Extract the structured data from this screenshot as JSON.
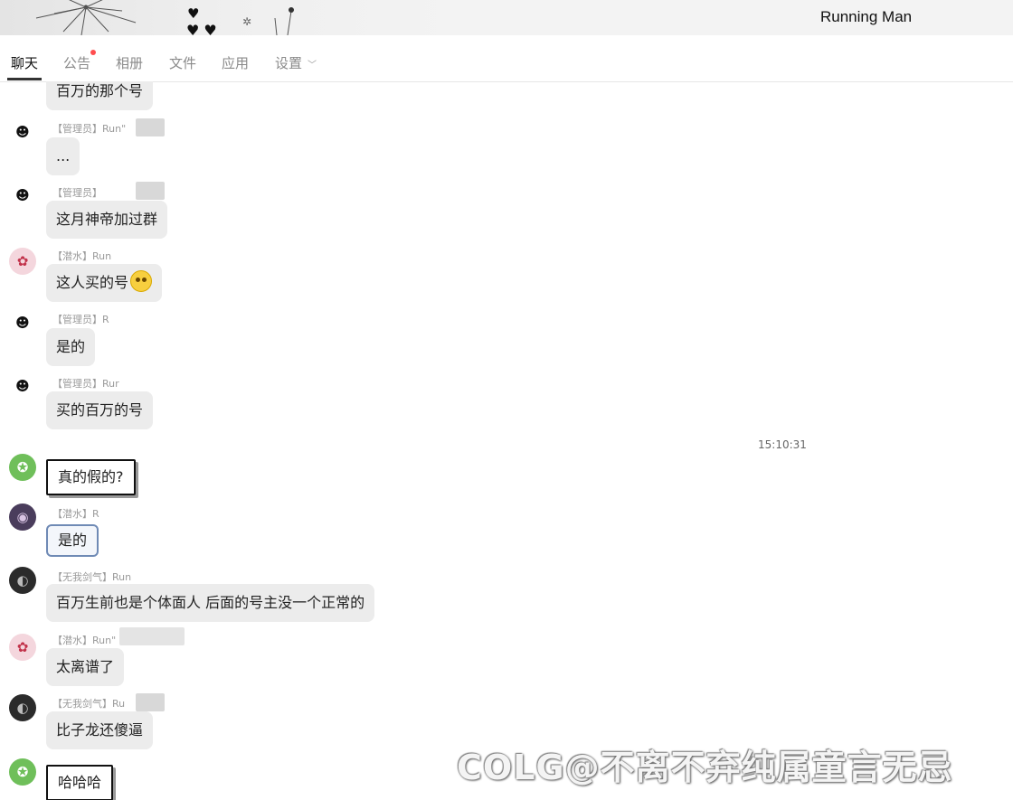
{
  "window": {
    "title": "Running Man"
  },
  "tabs": [
    {
      "label": "聊天",
      "active": true
    },
    {
      "label": "公告",
      "has_notification": true
    },
    {
      "label": "相册"
    },
    {
      "label": "文件"
    },
    {
      "label": "应用"
    },
    {
      "label": "设置",
      "has_dropdown": true
    }
  ],
  "messages": [
    {
      "text": "百万的那个号"
    },
    {
      "sender": "【管理员】Run\"",
      "text": "..."
    },
    {
      "sender": "【管理员】",
      "text": "这月神帝加过群"
    },
    {
      "sender": "【潜水】Run",
      "text": "这人买的号",
      "emoji": "thinking-face"
    },
    {
      "sender": "【管理员】R",
      "text": "是的"
    },
    {
      "sender": "【管理员】Rur",
      "text": "买的百万的号"
    },
    {
      "text": "真的假的?"
    },
    {
      "sender": "【潜水】R",
      "text": "是的"
    },
    {
      "sender": "【无我剑气】Run",
      "text": "百万生前也是个体面人 后面的号主没一个正常的"
    },
    {
      "sender": "【潜水】Run\"",
      "text": "太离谱了"
    },
    {
      "sender": "【无我剑气】Ru",
      "text": "比子龙还傻逼"
    },
    {
      "text": "哈哈哈"
    }
  ],
  "timestamp": "15:10:31",
  "watermark": "COLG@不离不弃纯属童言无忌",
  "colors": {
    "accent": "#333333",
    "bubble": "#ececec",
    "notification": "#ff4d4f"
  }
}
